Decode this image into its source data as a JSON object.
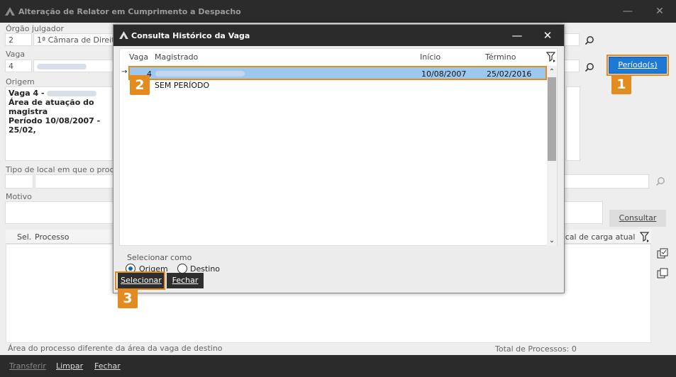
{
  "main_window": {
    "title": "Alteração de Relator em Cumprimento a Despacho",
    "orgao_label": "Órgão julgador",
    "orgao_code": "2",
    "orgao_name": "1ª Câmara de Direito",
    "vaga_label": "Vaga",
    "vaga_value": "4",
    "origem_label": "Origem",
    "origem_line1": "Vaga 4 -",
    "origem_line2": "Área de atuação do magistra",
    "origem_line3": "Período 10/08/2007 -  25/02,",
    "tipo_local_label": "Tipo de local em que o proces",
    "motivo_label": "Motivo",
    "periodo_button": "Período(s)",
    "consultar_button": "Consultar",
    "grid_col_sel": "Sel.",
    "grid_col_processo": "Processo",
    "grid_col_local": "ocal de carga atual",
    "footer_area_note": "Área do processo diferente da área da vaga de destino",
    "footer_total": "Total de Processos: 0",
    "bottom_transferir": "Transferir",
    "bottom_limpar": "Limpar",
    "bottom_fechar": "Fechar"
  },
  "dialog": {
    "title": "Consulta Histórico da Vaga",
    "columns": {
      "vaga": "Vaga",
      "magistrado": "Magistrado",
      "inicio": "Início",
      "termino": "Término"
    },
    "rows": [
      {
        "vaga": "4",
        "inicio": "10/08/2007",
        "termino": "25/02/2016"
      },
      {
        "vaga": "",
        "magistrado": "SEM PERÍODO",
        "inicio": "",
        "termino": ""
      }
    ],
    "selecionar_como_label": "Selecionar como",
    "radio_origem": "Origem",
    "radio_destino": "Destino",
    "selecionar_button": "Selecionar",
    "fechar_button": "Fechar"
  },
  "badges": {
    "b1": "1",
    "b2": "2",
    "b3": "3"
  },
  "colors": {
    "accent_orange": "#e38b1f",
    "primary_blue": "#1e78d6",
    "selection_blue": "#9cc8f0",
    "titlebar_dark": "#2b2b2b"
  }
}
